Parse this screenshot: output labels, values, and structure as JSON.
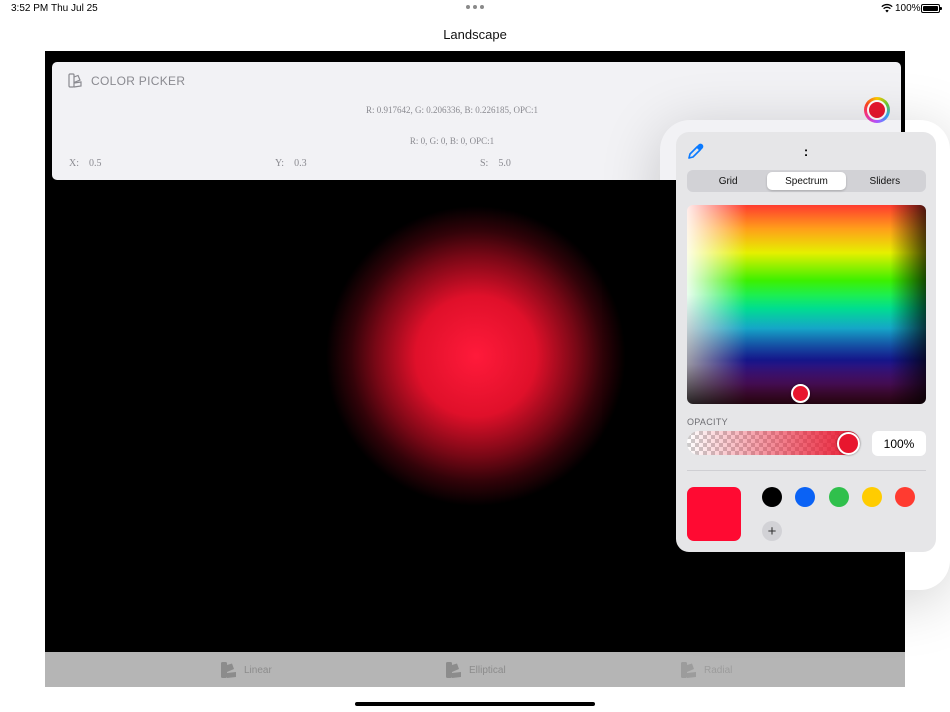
{
  "status_bar": {
    "time": "3:52 PM",
    "date": "Thu Jul 25",
    "battery": "100%"
  },
  "nav": {
    "title": "Landscape"
  },
  "card": {
    "title": "COLOR PICKER",
    "rgb_selected": "R: 0.917642, G: 0.206336, B:  0.226185, OPC:1",
    "rgb_current": "R: 0, G: 0, B: 0, OPC:1",
    "x_label": "X:",
    "x_value": "0.5",
    "y_label": "Y:",
    "y_value": "0.3",
    "s_label": "S:",
    "s_value": "5.0",
    "selected_color": "#e8162e"
  },
  "tabs": [
    {
      "label": "Linear"
    },
    {
      "label": "Elliptical"
    },
    {
      "label": "Radial"
    }
  ],
  "picker": {
    "title": ":",
    "segments": [
      {
        "label": "Grid",
        "active": false
      },
      {
        "label": "Spectrum",
        "active": true
      },
      {
        "label": "Sliders",
        "active": false
      }
    ],
    "opacity_label": "OPACITY",
    "opacity_value": "100%",
    "opacity_fraction": 1.0,
    "current_color": "#ff0a32",
    "swatches": [
      "#000000",
      "#0a62f5",
      "#30c04c",
      "#ffcc00",
      "#ff3b30"
    ],
    "add_symbol": "+"
  },
  "icons": [
    "eyedropper-icon",
    "swatches-icon",
    "wifi-icon",
    "battery-icon",
    "plus-icon"
  ]
}
